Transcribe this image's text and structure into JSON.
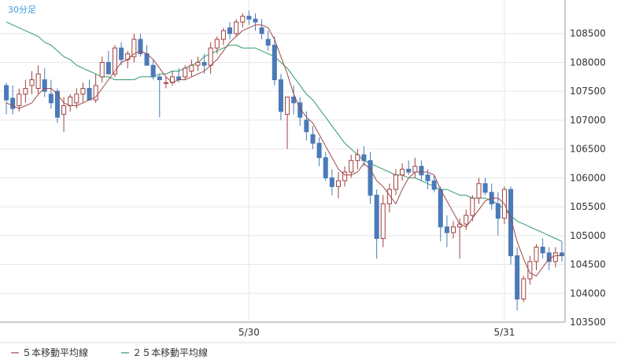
{
  "timeframe_label": "30分足",
  "chart_data": {
    "type": "candlestick",
    "title": "",
    "xlabel": "",
    "ylabel": "",
    "ylim": [
      103500,
      109000
    ],
    "y_ticks": [
      "108500",
      "108000",
      "107500",
      "107000",
      "106500",
      "106000",
      "105500",
      "105000",
      "104500",
      "104000",
      "103500"
    ],
    "x_ticks": [
      {
        "label": "5/30",
        "index": 38
      },
      {
        "label": "5/31",
        "index": 78
      }
    ],
    "grid": true,
    "legend_position": "bottom-left",
    "colors": {
      "up": "#ffffff",
      "up_border": "#a04040",
      "down": "#4a7ab8",
      "ma5": "#a04848",
      "ma25": "#2f9a6a",
      "grid": "#e8e8e8",
      "axis": "#999999"
    },
    "series": [
      {
        "name": "５本移動平均線",
        "kind": "ma5"
      },
      {
        "name": "２５本移動平均線",
        "kind": "ma25"
      }
    ],
    "candles": [
      [
        107600,
        107650,
        107100,
        107350
      ],
      [
        107380,
        107600,
        107100,
        107200
      ],
      [
        107250,
        107550,
        107150,
        107450
      ],
      [
        107450,
        107700,
        107300,
        107550
      ],
      [
        107600,
        107850,
        107450,
        107700
      ],
      [
        107550,
        107950,
        107450,
        107800
      ],
      [
        107700,
        107900,
        107400,
        107500
      ],
      [
        107450,
        107700,
        107200,
        107300
      ],
      [
        107500,
        107550,
        106950,
        107050
      ],
      [
        107100,
        107400,
        106800,
        107250
      ],
      [
        107250,
        107450,
        107150,
        107400
      ],
      [
        107300,
        107550,
        107200,
        107450
      ],
      [
        107450,
        107650,
        107300,
        107550
      ],
      [
        107550,
        107700,
        107400,
        107350
      ],
      [
        107350,
        107800,
        107300,
        107600
      ],
      [
        107750,
        108100,
        107650,
        108000
      ],
      [
        108000,
        108200,
        107850,
        107800
      ],
      [
        107800,
        108300,
        107750,
        108250
      ],
      [
        108250,
        108350,
        107950,
        108050
      ],
      [
        108050,
        108200,
        107900,
        108150
      ],
      [
        108100,
        108500,
        108000,
        108400
      ],
      [
        108400,
        108500,
        108100,
        108150
      ],
      [
        108150,
        108300,
        107950,
        107950
      ],
      [
        107950,
        108050,
        107700,
        107750
      ],
      [
        107750,
        107800,
        107050,
        107700
      ],
      [
        107650,
        107750,
        107550,
        107650
      ],
      [
        107650,
        107850,
        107600,
        107750
      ],
      [
        107750,
        107900,
        107650,
        107700
      ],
      [
        107750,
        107950,
        107700,
        107900
      ],
      [
        107850,
        108050,
        107750,
        107950
      ],
      [
        107950,
        108100,
        107850,
        108000
      ],
      [
        108000,
        108150,
        107800,
        107950
      ],
      [
        107950,
        108350,
        107800,
        108250
      ],
      [
        108250,
        108450,
        108150,
        108400
      ],
      [
        108400,
        108600,
        108300,
        108550
      ],
      [
        108600,
        108700,
        108400,
        108500
      ],
      [
        108500,
        108750,
        108450,
        108700
      ],
      [
        108700,
        108850,
        108600,
        108800
      ],
      [
        108800,
        108900,
        108650,
        108750
      ],
      [
        108750,
        108850,
        108550,
        108700
      ],
      [
        108600,
        108750,
        108400,
        108500
      ],
      [
        108400,
        108550,
        108200,
        108300
      ],
      [
        108300,
        108450,
        107600,
        107700
      ],
      [
        107700,
        107800,
        107000,
        107150
      ],
      [
        107100,
        107250,
        106500,
        107400
      ],
      [
        107400,
        107600,
        107100,
        107300
      ],
      [
        107300,
        107400,
        106900,
        107050
      ],
      [
        107000,
        107150,
        106650,
        106800
      ],
      [
        106750,
        106900,
        106500,
        106600
      ],
      [
        106600,
        106700,
        106200,
        106350
      ],
      [
        106350,
        106450,
        105950,
        106000
      ],
      [
        106000,
        106150,
        105700,
        105850
      ],
      [
        105850,
        106100,
        105650,
        105950
      ],
      [
        105950,
        106200,
        105850,
        106100
      ],
      [
        106100,
        106400,
        106000,
        106300
      ],
      [
        106300,
        106500,
        106150,
        106400
      ],
      [
        106400,
        106550,
        106200,
        106300
      ],
      [
        106300,
        106450,
        105550,
        105700
      ],
      [
        105700,
        105800,
        104600,
        104950
      ],
      [
        104950,
        105700,
        104800,
        105550
      ],
      [
        105550,
        105900,
        105400,
        105800
      ],
      [
        105800,
        106150,
        105700,
        106050
      ],
      [
        106050,
        106250,
        105950,
        106150
      ],
      [
        106150,
        106300,
        106050,
        106100
      ],
      [
        106100,
        106350,
        106000,
        106200
      ],
      [
        106200,
        106300,
        105950,
        106050
      ],
      [
        106050,
        106150,
        105800,
        105950
      ],
      [
        105950,
        106050,
        105750,
        105800
      ],
      [
        105800,
        105850,
        104900,
        105150
      ],
      [
        105150,
        105350,
        104800,
        105050
      ],
      [
        105050,
        105250,
        104950,
        105150
      ],
      [
        105150,
        105300,
        104600,
        105200
      ],
      [
        105200,
        105450,
        105100,
        105350
      ],
      [
        105350,
        105700,
        105250,
        105650
      ],
      [
        105650,
        106000,
        105550,
        105900
      ],
      [
        105900,
        106000,
        105700,
        105750
      ],
      [
        105750,
        105900,
        105450,
        105550
      ],
      [
        105550,
        105750,
        105000,
        105300
      ],
      [
        105300,
        105850,
        105200,
        105800
      ],
      [
        105800,
        105850,
        104500,
        104650
      ],
      [
        104650,
        104800,
        103700,
        103900
      ],
      [
        103900,
        104300,
        103850,
        104250
      ],
      [
        104250,
        104650,
        104150,
        104550
      ],
      [
        104550,
        104850,
        104400,
        104800
      ],
      [
        104800,
        104950,
        104600,
        104700
      ],
      [
        104700,
        104800,
        104400,
        104550
      ],
      [
        104550,
        104800,
        104450,
        104700
      ],
      [
        104700,
        104900,
        104550,
        104650
      ]
    ],
    "ma5": [
      107300,
      107250,
      107200,
      107250,
      107300,
      107450,
      107550,
      107550,
      107450,
      107300,
      107250,
      107250,
      107300,
      107350,
      107400,
      107550,
      107700,
      107850,
      108000,
      108050,
      108150,
      108200,
      108150,
      108050,
      107900,
      107750,
      107650,
      107700,
      107700,
      107750,
      107800,
      107850,
      107950,
      108050,
      108200,
      108350,
      108450,
      108550,
      108600,
      108650,
      108650,
      108600,
      108400,
      108100,
      107800,
      107450,
      107200,
      107050,
      106950,
      106750,
      106550,
      106350,
      106150,
      106050,
      106050,
      106100,
      106250,
      106150,
      105950,
      105850,
      105700,
      105550,
      105800,
      106000,
      106100,
      106100,
      106100,
      106050,
      105800,
      105600,
      105400,
      105200,
      105150,
      105300,
      105450,
      105600,
      105650,
      105650,
      105550,
      105300,
      104900,
      104600,
      104350,
      104300,
      104450,
      104600,
      104650,
      104650
    ],
    "ma25": [
      108700,
      108650,
      108600,
      108550,
      108500,
      108450,
      108350,
      108300,
      108200,
      108100,
      108050,
      107950,
      107900,
      107850,
      107800,
      107750,
      107750,
      107700,
      107700,
      107700,
      107700,
      107750,
      107750,
      107750,
      107800,
      107800,
      107850,
      107850,
      107900,
      107950,
      108000,
      108100,
      108150,
      108200,
      108250,
      108300,
      108300,
      108250,
      108250,
      108250,
      108200,
      108150,
      108100,
      108000,
      107900,
      107750,
      107600,
      107450,
      107350,
      107200,
      107050,
      106900,
      106750,
      106600,
      106500,
      106400,
      106300,
      106250,
      106200,
      106150,
      106100,
      106050,
      106050,
      106000,
      106000,
      105950,
      105900,
      105850,
      105800,
      105800,
      105750,
      105700,
      105700,
      105650,
      105650,
      105650,
      105600,
      105550,
      105450,
      105350,
      105250,
      105200,
      105150,
      105100,
      105050,
      105000,
      104950,
      104900
    ]
  }
}
